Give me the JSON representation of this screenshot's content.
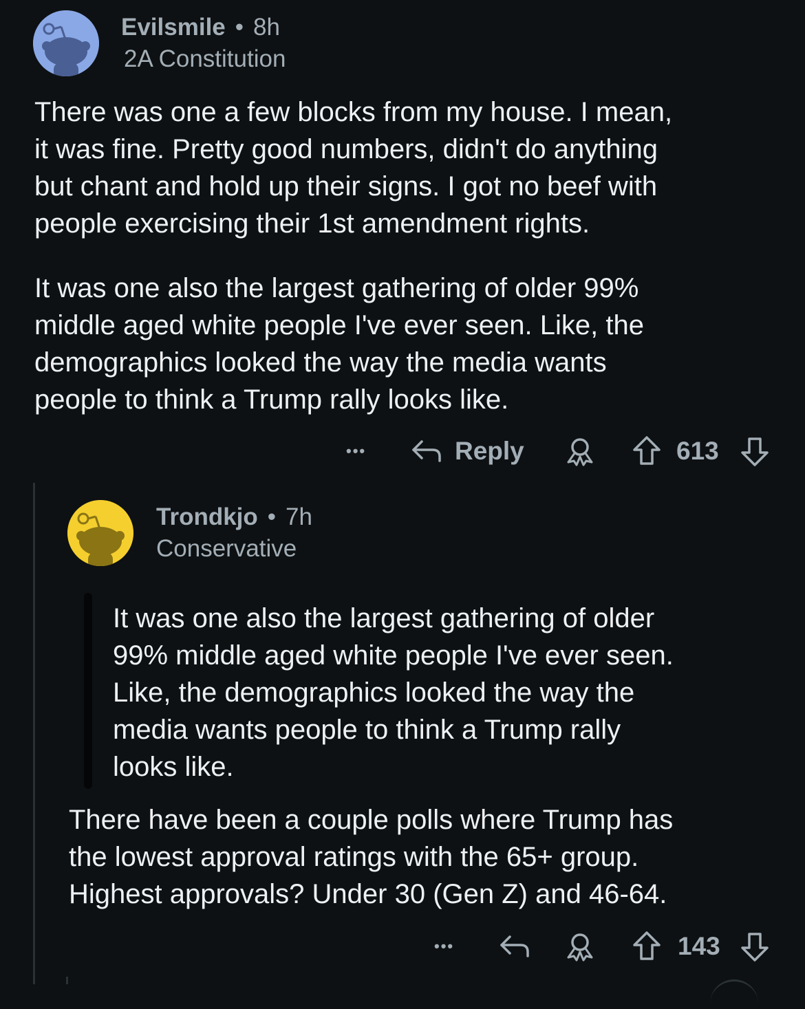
{
  "comments": [
    {
      "username": "Evilsmile",
      "separator": "•",
      "time": "8h",
      "flair": "2A Constitution",
      "paragraphs": [
        "There was one a few blocks from my house. I mean,\nit was fine. Pretty good numbers, didn't do anything\nbut chant and hold up their signs. I got no beef with\npeople exercising their 1st amendment rights.",
        "It was one also the largest gathering of older 99%\nmiddle aged white people I've ever seen. Like, the\ndemographics looked the way the media wants\npeople to think a Trump rally looks like."
      ],
      "more_label": "•••",
      "reply_label": "Reply",
      "vote_count": "613",
      "avatar_color": "#8aa8e6"
    },
    {
      "username": "Trondkjo",
      "separator": "•",
      "time": "7h",
      "flair": "Conservative",
      "quote": "It was one also the largest gathering of older\n99% middle aged white people I've ever seen.\nLike, the demographics looked the way the\nmedia wants people to think a Trump rally\nlooks like.",
      "paragraphs": [
        "There have been a couple polls where Trump has\nthe lowest approval ratings with the 65+ group.\nHighest approvals? Under 30 (Gen Z) and 46-64."
      ],
      "more_label": "•••",
      "vote_count": "143",
      "avatar_color": "#f5cf2e"
    }
  ],
  "icons": {
    "avatar": "snoo-avatar-icon",
    "reply": "reply-arrow-icon",
    "award": "award-icon",
    "upvote": "upvote-arrow-icon",
    "downvote": "downvote-arrow-icon"
  },
  "colors": {
    "background": "#0e1113",
    "text": "#eef1f3",
    "meta": "#a3aeb6"
  }
}
